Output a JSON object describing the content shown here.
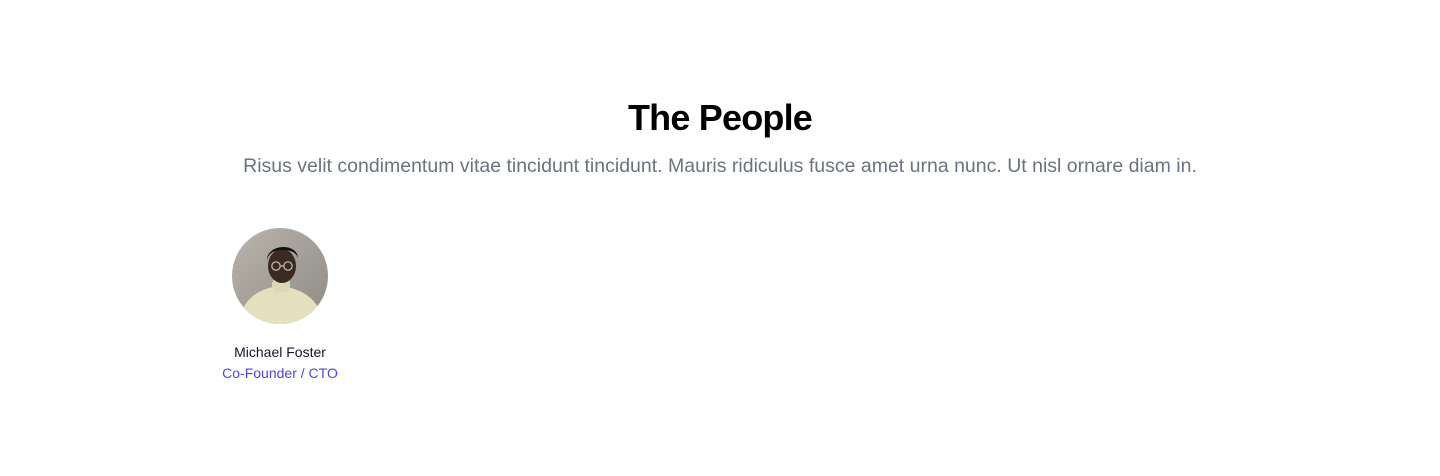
{
  "team": {
    "title": "The People",
    "description": "Risus velit condimentum vitae tincidunt tincidunt. Mauris ridiculus fusce amet urna nunc. Ut nisl ornare diam in.",
    "members": [
      {
        "name": "Michael Foster",
        "role": "Co-Founder / CTO",
        "avatar_icon": "person-portrait"
      }
    ]
  },
  "colors": {
    "title": "#000000",
    "description": "#6b7280",
    "name": "#111827",
    "role_accent": "#4f46e5",
    "avatar_background": "#a8a49c"
  }
}
